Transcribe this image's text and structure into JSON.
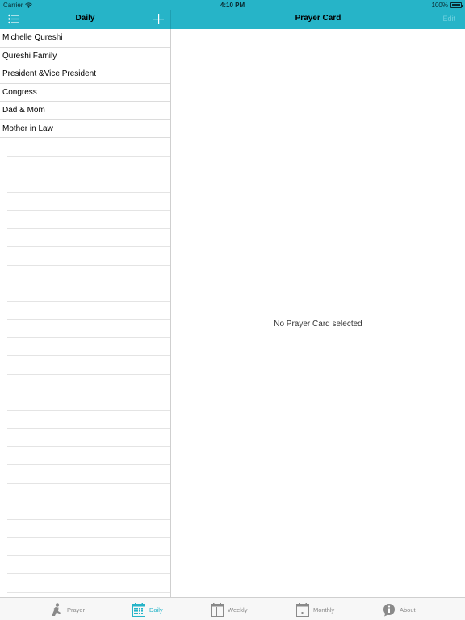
{
  "status_bar": {
    "carrier": "Carrier",
    "time": "4:10 PM",
    "battery": "100%"
  },
  "master_nav": {
    "title": "Daily"
  },
  "detail_nav": {
    "title": "Prayer Card",
    "edit_label": "Edit"
  },
  "prayer_list": [
    {
      "label": "Michelle Qureshi"
    },
    {
      "label": "Qureshi Family"
    },
    {
      "label": "President &Vice President"
    },
    {
      "label": "Congress"
    },
    {
      "label": "Dad & Mom"
    },
    {
      "label": "Mother in Law"
    }
  ],
  "detail": {
    "empty_message": "No Prayer Card selected"
  },
  "tabs": [
    {
      "label": "Prayer",
      "icon": "praying-person-icon"
    },
    {
      "label": "Daily",
      "icon": "calendar-grid-icon",
      "active": true
    },
    {
      "label": "Weekly",
      "icon": "calendar-week-icon"
    },
    {
      "label": "Monthly",
      "icon": "calendar-month-icon"
    },
    {
      "label": "About",
      "icon": "info-bubble-icon"
    }
  ],
  "colors": {
    "accent": "#26b4c8",
    "tab_inactive": "#8a8a8a",
    "edit_disabled": "#6fd1de"
  }
}
